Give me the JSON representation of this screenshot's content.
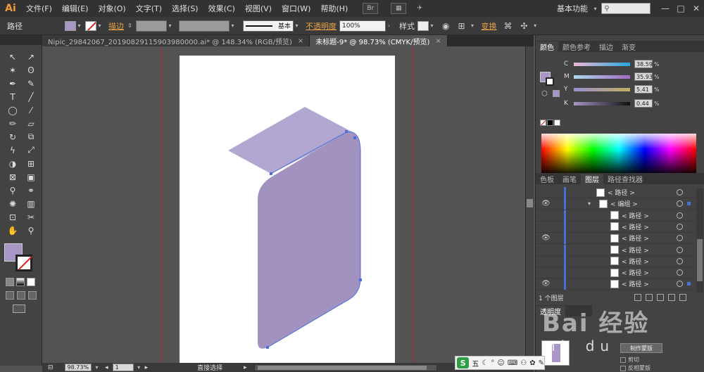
{
  "menubar": {
    "logo": "Ai",
    "items": [
      "文件(F)",
      "编辑(E)",
      "对象(O)",
      "文字(T)",
      "选择(S)",
      "效果(C)",
      "视图(V)",
      "窗口(W)",
      "帮助(H)"
    ],
    "br_icon": "Br",
    "workspace": "基本功能",
    "search_placeholder": "",
    "window_controls": [
      "—",
      "□",
      "✕"
    ]
  },
  "controlbar": {
    "object_label": "路径",
    "stroke_label": "描边",
    "stroke_style": "基本",
    "opacity_label": "不透明度",
    "opacity_value": "100%",
    "style_label": "样式",
    "transform_label": "变换",
    "fill_color": "#a896c6"
  },
  "tabs": [
    {
      "label": "Nipic_29842067_20190829115903980000.ai* @ 148.34% (RGB/预览)",
      "close": "×",
      "active": false
    },
    {
      "label": "未标题-9* @ 98.73% (CMYK/预览)",
      "close": "×",
      "active": true
    }
  ],
  "tools": {
    "icons": [
      "selection-icon",
      "direct-selection-icon",
      "magic-wand-icon",
      "lasso-icon",
      "pen-icon",
      "curvature-icon",
      "type-icon",
      "line-icon",
      "ellipse-icon",
      "paintbrush-icon",
      "pencil-icon",
      "eraser-icon",
      "rotate-icon",
      "scale-icon",
      "warp-icon",
      "free-transform-icon",
      "shape-builder-icon",
      "perspective-grid-icon",
      "mesh-icon",
      "gradient-icon",
      "eyedropper-icon",
      "blend-icon",
      "symbol-sprayer-icon",
      "column-graph-icon",
      "artboard-icon",
      "slice-icon",
      "hand-icon",
      "zoom-icon"
    ],
    "glyphs": [
      "↖",
      "↗",
      "✶",
      "ʘ",
      "✒",
      "✎",
      "T",
      "╱",
      "◯",
      "⁄",
      "✏",
      "▱",
      "↻",
      "⧉",
      "ϟ",
      "⤢",
      "◑",
      "⊞",
      "⊠",
      "▣",
      "⚲",
      "⚭",
      "✺",
      "▥",
      "⊡",
      "✂",
      "✋",
      "⚲"
    ],
    "fill_color": "#a896c6"
  },
  "statusbar": {
    "zoom": "98.73%",
    "page": "1",
    "status_text": "直接选择"
  },
  "color_panel": {
    "tabs": [
      "颜色",
      "颜色参考",
      "描边",
      "渐变"
    ],
    "sliders": [
      {
        "label": "C",
        "value": "38.59",
        "pct": "%"
      },
      {
        "label": "M",
        "value": "35.93",
        "pct": "%"
      },
      {
        "label": "Y",
        "value": "5.41",
        "pct": "%"
      },
      {
        "label": "K",
        "value": "0.44",
        "pct": "%"
      }
    ]
  },
  "layers_panel": {
    "tabs": [
      "色板",
      "画笔",
      "图层",
      "路径查找器"
    ],
    "rows": [
      {
        "name": "< 路径 >",
        "eye": ""
      },
      {
        "name": "< 编组 >",
        "eye": "👁"
      },
      {
        "name": "< 路径 >",
        "eye": ""
      },
      {
        "name": "< 路径 >",
        "eye": ""
      },
      {
        "name": "< 路径 >",
        "eye": "👁"
      },
      {
        "name": "< 路径 >",
        "eye": ""
      },
      {
        "name": "< 路径 >",
        "eye": ""
      },
      {
        "name": "< 路径 >",
        "eye": ""
      },
      {
        "name": "< 路径 >",
        "eye": "👁"
      }
    ],
    "footer": "1 个图层"
  },
  "transparency_panel": {
    "tab": "透明度",
    "make_mask": "制作蒙版",
    "clip": "剪切",
    "invert": "反相蒙版"
  },
  "watermark": {
    "text": "Bai 经验",
    "sub": "nb du"
  },
  "ime": {
    "logo": "S",
    "mode": "五"
  },
  "artwork": {
    "top_face_color": "#b1a7d0",
    "front_face_color": "#a192bf"
  }
}
